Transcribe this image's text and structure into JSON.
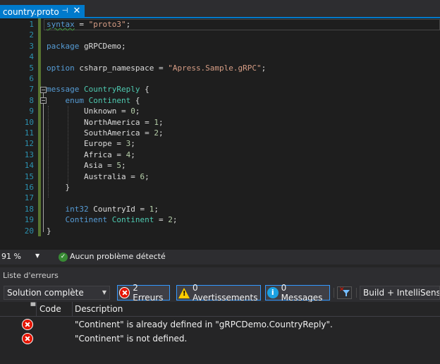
{
  "tab": {
    "title": "country.proto",
    "pin_icon": "pin-icon",
    "close_icon": "close-icon"
  },
  "editor": {
    "lines": [
      {
        "num": "1",
        "tokens": [
          {
            "t": "syntax",
            "c": "syn"
          },
          {
            "t": " = ",
            "c": "id"
          },
          {
            "t": "\"proto3\"",
            "c": "str"
          },
          {
            "t": ";",
            "c": "id"
          }
        ]
      },
      {
        "num": "2",
        "tokens": []
      },
      {
        "num": "3",
        "tokens": [
          {
            "t": "package",
            "c": "kw"
          },
          {
            "t": " gRPCDemo;",
            "c": "id"
          }
        ]
      },
      {
        "num": "4",
        "tokens": []
      },
      {
        "num": "5",
        "tokens": [
          {
            "t": "option",
            "c": "kw"
          },
          {
            "t": " csharp_namespace = ",
            "c": "id"
          },
          {
            "t": "\"Apress.Sample.gRPC\"",
            "c": "str"
          },
          {
            "t": ";",
            "c": "id"
          }
        ]
      },
      {
        "num": "6",
        "tokens": []
      },
      {
        "num": "7",
        "tokens": [
          {
            "t": "message",
            "c": "kw"
          },
          {
            "t": " ",
            "c": "id"
          },
          {
            "t": "CountryReply",
            "c": "ty"
          },
          {
            "t": " {",
            "c": "id"
          }
        ]
      },
      {
        "num": "8",
        "tokens": [
          {
            "t": "    ",
            "c": "id"
          },
          {
            "t": "enum",
            "c": "kw"
          },
          {
            "t": " ",
            "c": "id"
          },
          {
            "t": "Continent",
            "c": "ty"
          },
          {
            "t": " {",
            "c": "id"
          }
        ]
      },
      {
        "num": "9",
        "tokens": [
          {
            "t": "        Unknown = ",
            "c": "id"
          },
          {
            "t": "0",
            "c": "num"
          },
          {
            "t": ";",
            "c": "id"
          }
        ]
      },
      {
        "num": "10",
        "tokens": [
          {
            "t": "        NorthAmerica = ",
            "c": "id"
          },
          {
            "t": "1",
            "c": "num"
          },
          {
            "t": ";",
            "c": "id"
          }
        ]
      },
      {
        "num": "11",
        "tokens": [
          {
            "t": "        SouthAmerica = ",
            "c": "id"
          },
          {
            "t": "2",
            "c": "num"
          },
          {
            "t": ";",
            "c": "id"
          }
        ]
      },
      {
        "num": "12",
        "tokens": [
          {
            "t": "        Europe = ",
            "c": "id"
          },
          {
            "t": "3",
            "c": "num"
          },
          {
            "t": ";",
            "c": "id"
          }
        ]
      },
      {
        "num": "13",
        "tokens": [
          {
            "t": "        Africa = ",
            "c": "id"
          },
          {
            "t": "4",
            "c": "num"
          },
          {
            "t": ";",
            "c": "id"
          }
        ]
      },
      {
        "num": "14",
        "tokens": [
          {
            "t": "        Asia = ",
            "c": "id"
          },
          {
            "t": "5",
            "c": "num"
          },
          {
            "t": ";",
            "c": "id"
          }
        ]
      },
      {
        "num": "15",
        "tokens": [
          {
            "t": "        Australia = ",
            "c": "id"
          },
          {
            "t": "6",
            "c": "num"
          },
          {
            "t": ";",
            "c": "id"
          }
        ]
      },
      {
        "num": "16",
        "tokens": [
          {
            "t": "    }",
            "c": "id"
          }
        ]
      },
      {
        "num": "17",
        "tokens": []
      },
      {
        "num": "18",
        "tokens": [
          {
            "t": "    ",
            "c": "id"
          },
          {
            "t": "int32",
            "c": "kw"
          },
          {
            "t": " CountryId = ",
            "c": "id"
          },
          {
            "t": "1",
            "c": "num"
          },
          {
            "t": ";",
            "c": "id"
          }
        ]
      },
      {
        "num": "19",
        "tokens": [
          {
            "t": "    ",
            "c": "id"
          },
          {
            "t": "Continent",
            "c": "kw"
          },
          {
            "t": " ",
            "c": "id"
          },
          {
            "t": "Continent",
            "c": "ty"
          },
          {
            "t": " = ",
            "c": "id"
          },
          {
            "t": "2",
            "c": "num"
          },
          {
            "t": ";",
            "c": "id"
          }
        ]
      },
      {
        "num": "20",
        "tokens": [
          {
            "t": "}",
            "c": "id"
          }
        ]
      }
    ]
  },
  "status": {
    "zoom": "91 %",
    "health": "Aucun problème détecté"
  },
  "error_list": {
    "title": "Liste d'erreurs",
    "scope": "Solution complète",
    "errors_label": "2 Erreurs",
    "warnings_label": "0 Avertissements",
    "messages_label": "0 Messages",
    "build_filter": "Build + IntelliSense",
    "columns": {
      "code": "Code",
      "description": "Description"
    },
    "rows": [
      {
        "description": "\"Continent\" is already defined in \"gRPCDemo.CountryReply\"."
      },
      {
        "description": "\"Continent\" is not defined."
      }
    ]
  },
  "colors": {
    "accent": "#007acc",
    "error": "#e51400",
    "warning": "#ffcc00",
    "info": "#1ba1e2",
    "ok": "#388a34"
  }
}
